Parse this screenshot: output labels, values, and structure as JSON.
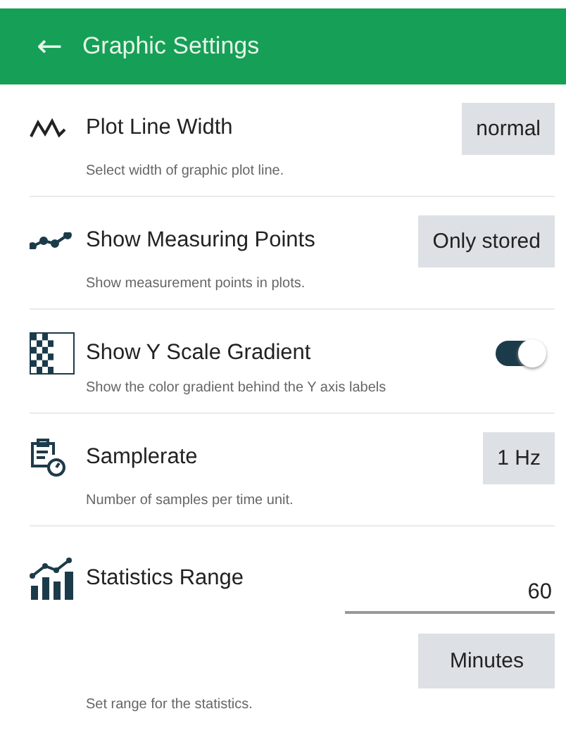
{
  "header": {
    "back": "←",
    "title": "Graphic Settings"
  },
  "settings": [
    {
      "kind": "button",
      "title": "Plot Line Width",
      "value": "normal",
      "description": "Select width of graphic plot line."
    },
    {
      "kind": "button",
      "title": "Show Measuring Points",
      "value": "Only stored",
      "description": "Show measurement points in plots."
    },
    {
      "kind": "toggle",
      "title": "Show Y Scale Gradient",
      "on": true,
      "description": "Show the color gradient behind the Y axis labels"
    },
    {
      "kind": "button",
      "title": "Samplerate",
      "value": "1 Hz",
      "description": "Number of samples per time unit."
    },
    {
      "kind": "range",
      "title": "Statistics Range",
      "value": "60",
      "unit": "Minutes",
      "description": "Set range for the statistics."
    }
  ]
}
